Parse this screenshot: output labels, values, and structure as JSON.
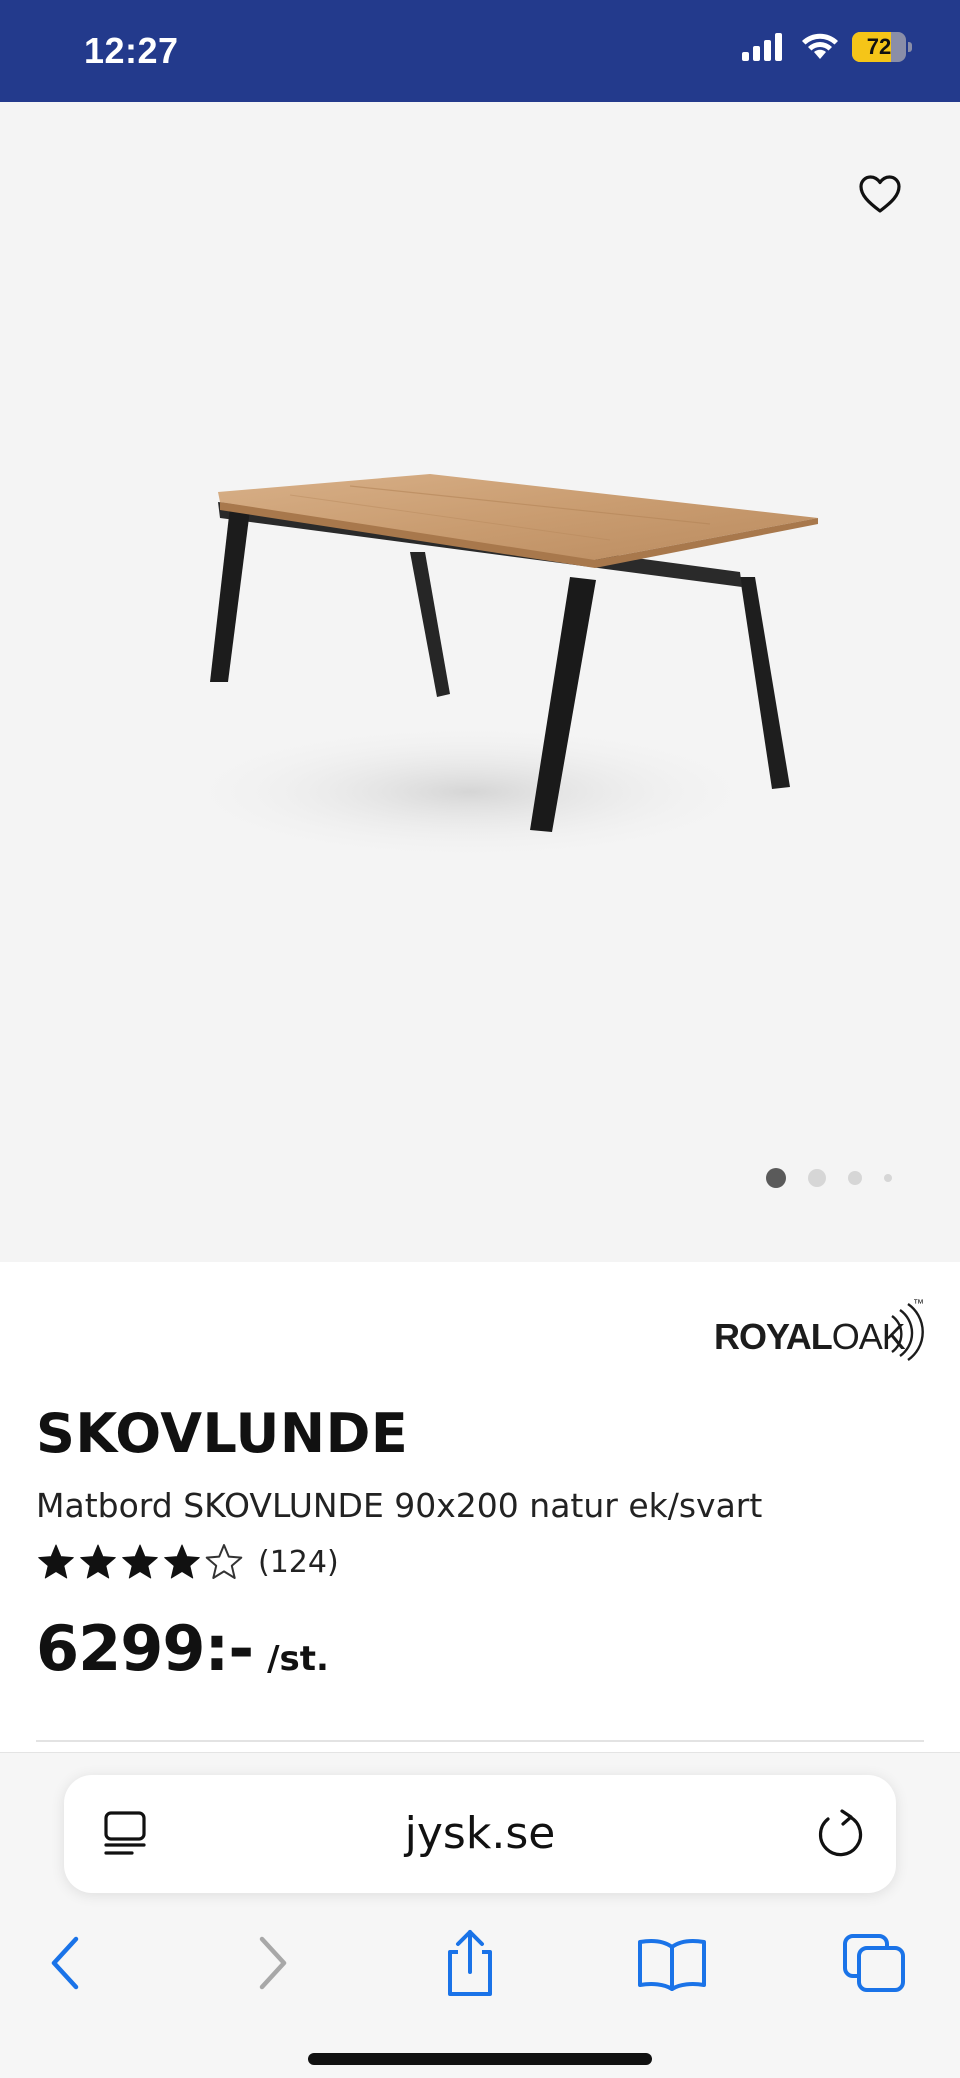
{
  "status_bar": {
    "time": "12:27",
    "battery_level": "72",
    "battery_fraction": 0.72,
    "icons": [
      "signal-icon",
      "wifi-icon",
      "battery-icon"
    ]
  },
  "gallery": {
    "wishlist_icon": "heart-outline-icon",
    "image_count": 4,
    "active_index": 0
  },
  "product": {
    "brand": {
      "logo_bold": "ROYAL",
      "logo_light": "OAK",
      "logo_tm": "™"
    },
    "name": "SKOVLUNDE",
    "description": "Matbord SKOVLUNDE 90x200 natur ek/svart",
    "rating": {
      "value": 4,
      "max": 5,
      "count_label": "(124)"
    },
    "price": "6299:-",
    "price_unit": "/st."
  },
  "browser": {
    "url": "jysk.se",
    "icons": [
      "reader-icon",
      "reload-icon",
      "back-icon",
      "forward-icon",
      "share-icon",
      "bookmarks-icon",
      "tabs-icon"
    ]
  },
  "colors": {
    "status_bar_bg": "#233a8c",
    "battery_fill": "#f5c518",
    "safari_accent": "#1a73e8",
    "text_primary": "#111111"
  }
}
